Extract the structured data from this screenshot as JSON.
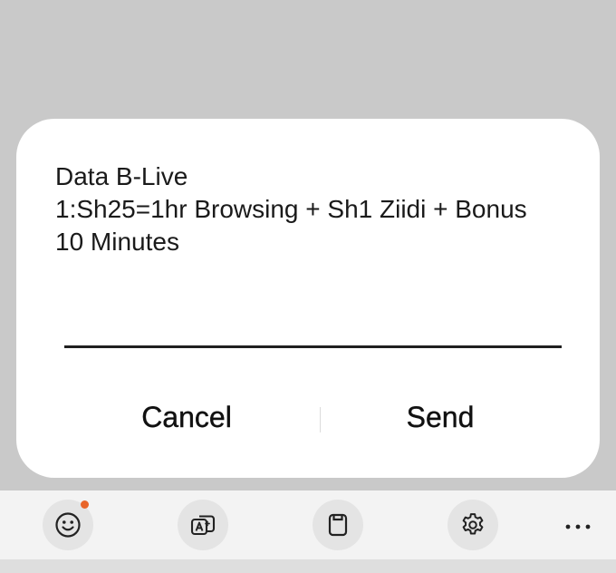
{
  "dialog": {
    "message_lines": [
      "Data B-Live",
      "1:Sh25=1hr Browsing + Sh1 Ziidi + Bonus",
      "10 Minutes"
    ],
    "cancel_label": "Cancel",
    "send_label": "Send"
  },
  "toolbar": {
    "items": [
      {
        "icon": "emoji-icon",
        "has_notification_dot": true
      },
      {
        "icon": "translate-icon"
      },
      {
        "icon": "clipboard-icon"
      },
      {
        "icon": "settings-gear-icon"
      },
      {
        "icon": "more-options-icon"
      }
    ]
  },
  "colors": {
    "background_dim": "#c9c9c9",
    "dialog": "#ffffff",
    "toolbar": "#f3f3f3",
    "notification_dot": "#e8652a"
  }
}
